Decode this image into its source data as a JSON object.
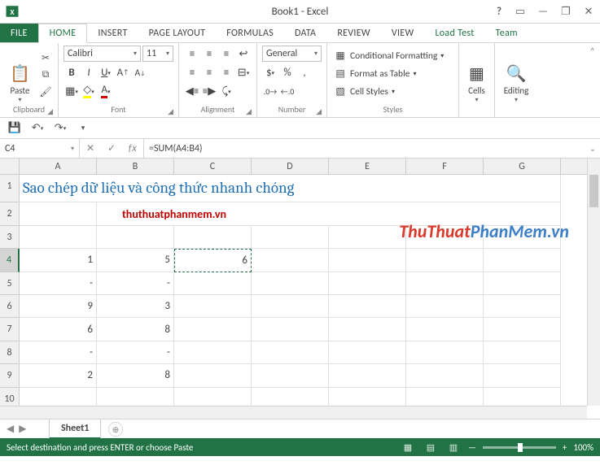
{
  "window": {
    "title": "Book1 - Excel"
  },
  "tabs": {
    "file": "FILE",
    "items": [
      "HOME",
      "INSERT",
      "PAGE LAYOUT",
      "FORMULAS",
      "DATA",
      "REVIEW",
      "VIEW"
    ],
    "ext": [
      "Load Test",
      "Team"
    ],
    "active": "HOME"
  },
  "ribbon": {
    "clipboard": {
      "paste": "Paste",
      "label": "Clipboard"
    },
    "font": {
      "name": "Calibri",
      "size": "11",
      "label": "Font"
    },
    "alignment": {
      "label": "Alignment"
    },
    "number": {
      "format": "General",
      "label": "Number"
    },
    "styles": {
      "cond": "Conditional Formatting",
      "table": "Format as Table",
      "cell": "Cell Styles",
      "label": "Styles"
    },
    "cells": {
      "label": "Cells"
    },
    "editing": {
      "label": "Editing"
    }
  },
  "formula": {
    "ref": "C4",
    "value": "=SUM(A4:B4)"
  },
  "columns": [
    "A",
    "B",
    "C",
    "D",
    "E",
    "F",
    "G"
  ],
  "rowheaders": [
    "1",
    "2",
    "3",
    "4",
    "5",
    "6",
    "7",
    "8",
    "9",
    "10"
  ],
  "content": {
    "title": "Sao chép dữ liệu và công thức nhanh chóng",
    "link": "thuthuatphanmem.vn",
    "data": {
      "A4": "1",
      "B4": "5",
      "C4": "6",
      "A5": "-",
      "B5": "-",
      "A6": "9",
      "B6": "3",
      "A7": "6",
      "B7": "8",
      "A8": "-",
      "B8": "-",
      "A9": "2",
      "B9": "8"
    }
  },
  "watermark": {
    "p1": "ThuThuat",
    "p2": "PhanMem.vn"
  },
  "sheets": {
    "active": "Sheet1"
  },
  "status": {
    "msg": "Select destination and press ENTER or choose Paste",
    "zoom": "100%"
  }
}
